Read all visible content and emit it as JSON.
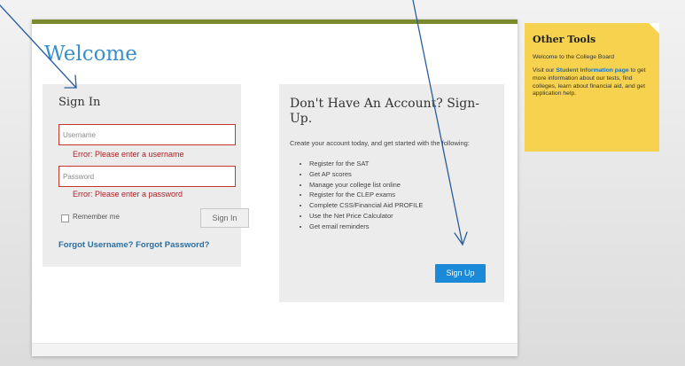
{
  "welcome": "Welcome",
  "signin": {
    "title": "Sign In",
    "username_placeholder": "Username",
    "username_error": "Error: Please enter a username",
    "password_placeholder": "Password",
    "password_error": "Error: Please enter a password",
    "remember": "Remember me",
    "button": "Sign In",
    "forgot": "Forgot Username? Forgot Password?"
  },
  "signup": {
    "title": "Don't Have An Account? Sign-Up.",
    "intro": "Create your account today, and get started with the following:",
    "items": [
      "Register for the SAT",
      "Get AP scores",
      "Manage your college list online",
      "Register for the CLEP exams",
      "Complete CSS/Financial Aid PROFILE",
      "Use the Net Price Calculator",
      "Get email reminders"
    ],
    "button": "Sign Up"
  },
  "tools": {
    "title": "Other Tools",
    "welcome": "Welcome to the College Board",
    "body_before": "Visit our ",
    "link": "Student Information page",
    "body_after": " to get more information about our tests, find colleges, learn about financial aid, and get application help."
  },
  "colors": {
    "accent": "#7a8b2e",
    "link": "#2c6ea0",
    "error": "#b01e23",
    "signup_button": "#1a8ad8",
    "tools_background": "#f6d24e"
  }
}
